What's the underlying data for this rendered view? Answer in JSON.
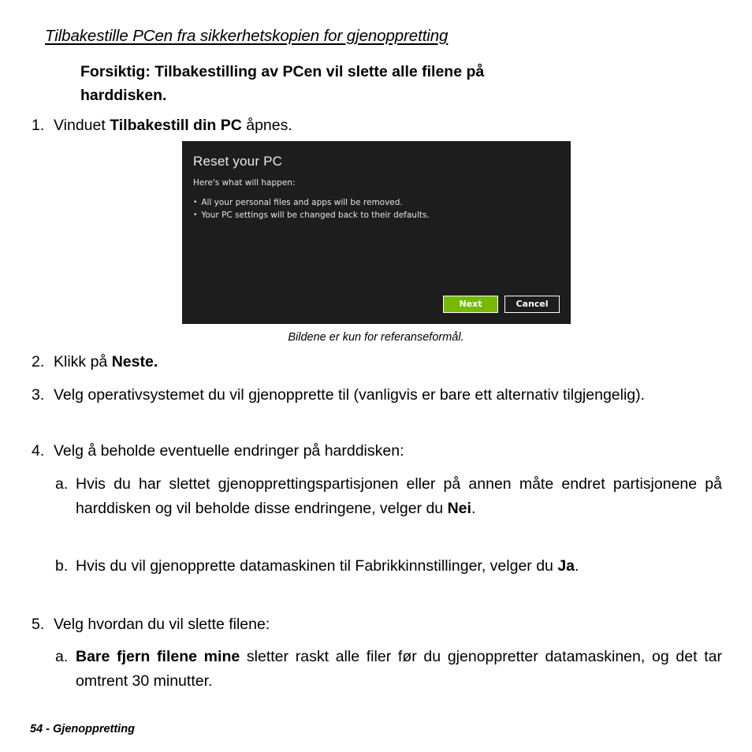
{
  "page": {
    "heading": "Tilbakestille PCen fra sikkerhetskopien for gjenoppretting",
    "caution_label": "Forsiktig:",
    "caution_text": "Tilbakestilling av PCen vil slette alle filene på",
    "caution_text_line2": "harddisken.",
    "footer": "54 - Gjenoppretting"
  },
  "figure": {
    "caption": "Bildene er kun for referanseformål.",
    "dialog": {
      "title": "Reset your PC",
      "subtitle": "Here's what will happen:",
      "bullets": [
        "All your personal files and apps will be removed.",
        "Your PC settings will be changed back to their defaults."
      ],
      "buttons": {
        "primary": "Next",
        "secondary": "Cancel"
      },
      "colors": {
        "background": "#1d1d1d",
        "primary_button": "#76b900",
        "text": "#e4e4e4"
      }
    }
  },
  "steps": [
    {
      "marker": "1.",
      "prefix": "Vinduet ",
      "bold": "Tilbakestill din PC",
      "suffix": " åpnes."
    },
    {
      "marker": "2.",
      "prefix": "Klikk på ",
      "bold": "Neste.",
      "suffix": ""
    },
    {
      "marker": "3.",
      "text": "Velg operativsystemet du vil gjenopprette til (vanligvis er bare ett alternativ tilgjengelig)."
    },
    {
      "marker": "4.",
      "text": "Velg å beholde eventuelle endringer på harddisken:"
    },
    {
      "marker": "5.",
      "text": "Velg hvordan du vil slette filene:"
    }
  ],
  "substeps_4": [
    {
      "marker": "a.",
      "prefix": "Hvis du har slettet gjenopprettingspartisjonen eller på annen måte endret partisjonene på harddisken og vil beholde disse endringene, velger du ",
      "bold": "Nei",
      "suffix": "."
    },
    {
      "marker": "b.",
      "prefix": "Hvis du vil gjenopprette datamaskinen til Fabrikkinnstillinger, velger du ",
      "bold": "Ja",
      "suffix": "."
    }
  ],
  "substeps_5": [
    {
      "marker": "a.",
      "prefix": "",
      "bold": "Bare fjern filene mine",
      "suffix": " sletter raskt alle filer før du gjenoppretter datamaskinen, og det tar omtrent 30 minutter."
    }
  ]
}
